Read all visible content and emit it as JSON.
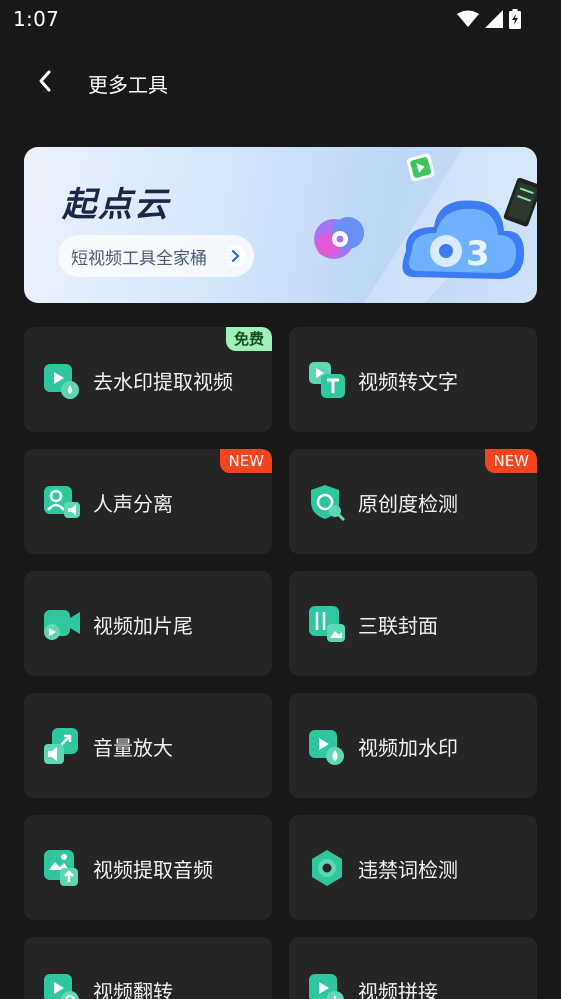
{
  "status_bar": {
    "time": "1:07",
    "icons": [
      "wifi-icon",
      "signal-icon",
      "battery-charging-icon"
    ]
  },
  "nav": {
    "back_icon": "chevron-left-icon",
    "title": "更多工具"
  },
  "banner": {
    "brand": "起点云",
    "subtitle": "短视频工具全家桶",
    "arrow_icon": "chevron-right-icon"
  },
  "colors": {
    "background": "#181818",
    "card": "#252525",
    "accent": "#2ec7a0",
    "badge_free": "#9ff2b6",
    "badge_new": "#f2441e"
  },
  "tools": [
    {
      "label": "去水印提取视频",
      "icon": "video-watermark-remove-icon",
      "badge": "免费",
      "badge_type": "free"
    },
    {
      "label": "视频转文字",
      "icon": "video-to-text-icon"
    },
    {
      "label": "人声分离",
      "icon": "voice-separate-icon",
      "badge": "NEW",
      "badge_type": "new"
    },
    {
      "label": "原创度检测",
      "icon": "originality-check-icon",
      "badge": "NEW",
      "badge_type": "new"
    },
    {
      "label": "视频加片尾",
      "icon": "video-outro-icon"
    },
    {
      "label": "三联封面",
      "icon": "triple-cover-icon"
    },
    {
      "label": "音量放大",
      "icon": "volume-amplify-icon"
    },
    {
      "label": "视频加水印",
      "icon": "video-add-watermark-icon"
    },
    {
      "label": "视频提取音频",
      "icon": "extract-audio-icon"
    },
    {
      "label": "违禁词检测",
      "icon": "banned-word-check-icon"
    },
    {
      "label": "视频翻转",
      "icon": "video-flip-icon"
    },
    {
      "label": "视频拼接",
      "icon": "video-merge-icon"
    }
  ]
}
